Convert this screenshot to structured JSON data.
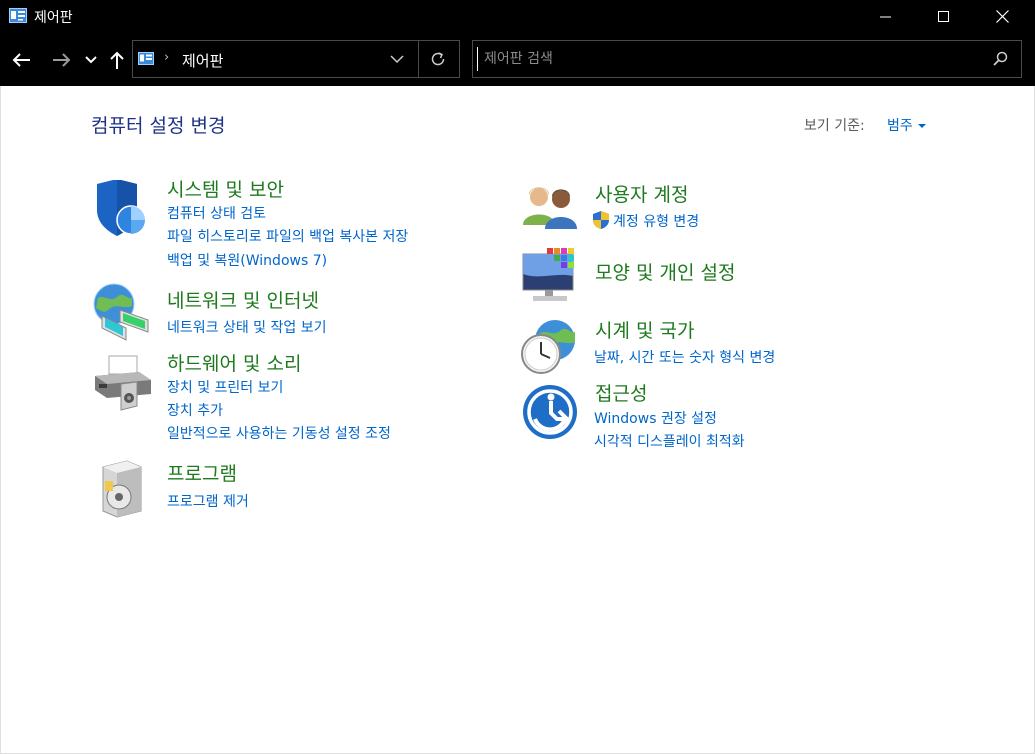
{
  "window": {
    "title": "제어판"
  },
  "address": {
    "crumb": "제어판",
    "separator": "›"
  },
  "search": {
    "placeholder": "제어판 검색"
  },
  "page": {
    "title": "컴퓨터 설정 변경",
    "view_by_label": "보기 기준:",
    "view_by_value": "범주"
  },
  "categories": {
    "system": {
      "title": "시스템 및 보안",
      "links": [
        "컴퓨터 상태 검토",
        "파일 히스토리로 파일의 백업 복사본 저장",
        "백업 및 복원(Windows 7)"
      ]
    },
    "network": {
      "title": "네트워크 및 인터넷",
      "links": [
        "네트워크 상태 및 작업 보기"
      ]
    },
    "hardware": {
      "title": "하드웨어 및 소리",
      "links": [
        "장치 및 프린터 보기",
        "장치 추가",
        "일반적으로 사용하는 기동성 설정 조정"
      ]
    },
    "programs": {
      "title": "프로그램",
      "links": [
        "프로그램 제거"
      ]
    },
    "accounts": {
      "title": "사용자 계정",
      "links": [
        "계정 유형 변경"
      ]
    },
    "appearance": {
      "title": "모양 및 개인 설정",
      "links": []
    },
    "clock": {
      "title": "시계 및 국가",
      "links": [
        "날짜, 시간 또는 숫자 형식 변경"
      ]
    },
    "access": {
      "title": "접근성",
      "links": [
        "Windows 권장 설정",
        "시각적 디스플레이 최적화"
      ]
    }
  },
  "colors": {
    "title_bar": "#000000",
    "category_title": "#1d7a1d",
    "link": "#0066cc",
    "page_title": "#1e3287"
  }
}
